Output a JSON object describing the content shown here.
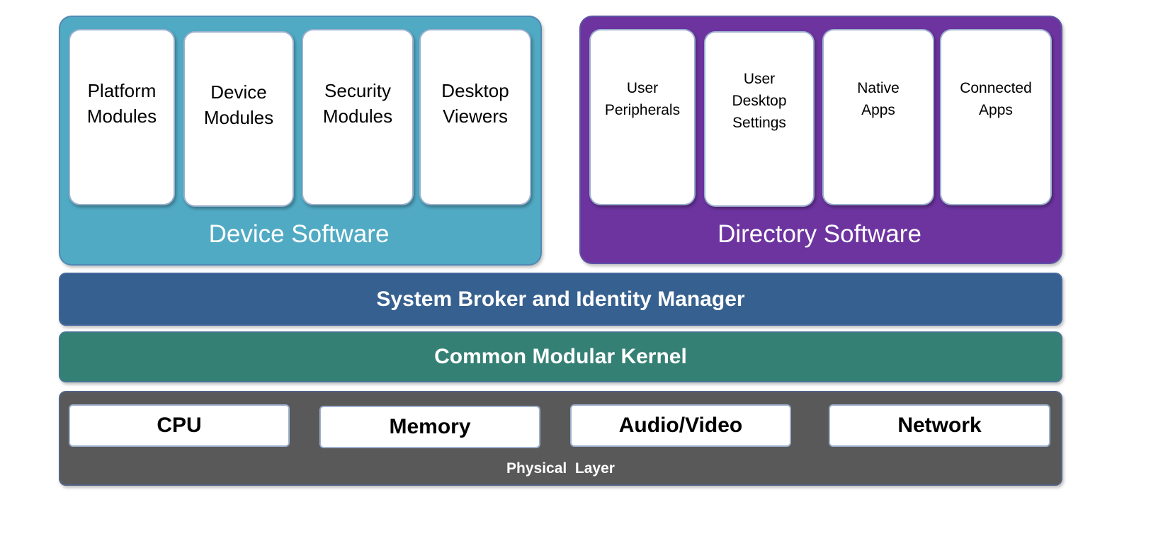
{
  "colors": {
    "device": "#50aac4",
    "directory": "#6d34a0",
    "broker": "#36608f",
    "kernel": "#358074",
    "physical": "#595959"
  },
  "device_software": {
    "label": "Device Software",
    "modules": [
      "Platform\nModules",
      "Device\nModules",
      "Security\nModules",
      "Desktop\nViewers"
    ]
  },
  "directory_software": {
    "label": "Directory Software",
    "modules": [
      "User\nPeripherals",
      "User\nDesktop\nSettings",
      "Native\nApps",
      "Connected\nApps"
    ]
  },
  "broker": {
    "label": "System Broker and Identity Manager"
  },
  "kernel": {
    "label": "Common Modular Kernel"
  },
  "physical": {
    "label": "Physical  Layer",
    "components": [
      "CPU",
      "Memory",
      "Audio/Video",
      "Network"
    ]
  }
}
